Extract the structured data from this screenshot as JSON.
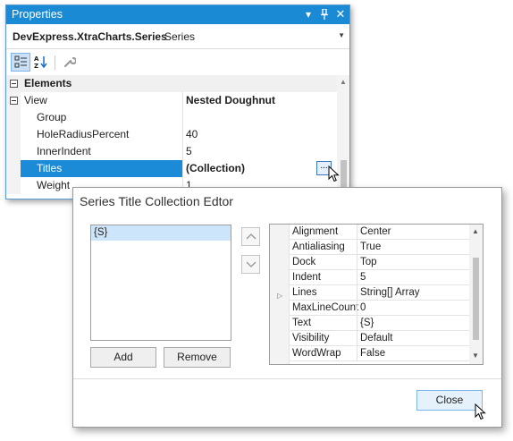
{
  "properties_window": {
    "title": "Properties",
    "title_buttons": {
      "dropdown": "▾",
      "pin": "📌",
      "close": "✕"
    },
    "object_name": "DevExpress.XtraCharts.Series",
    "object_type": "Series",
    "toolbar": {
      "categorized_icon": "categorized-icon",
      "alphabetical_icon": "alphabetical-icon",
      "property_pages_icon": "wrench-icon"
    },
    "rows": [
      {
        "name": "Elements",
        "value": ""
      },
      {
        "name": "View",
        "value": "Nested Doughnut"
      },
      {
        "name": "Group",
        "value": ""
      },
      {
        "name": "HoleRadiusPercent",
        "value": "40"
      },
      {
        "name": "InnerIndent",
        "value": "5"
      },
      {
        "name": "Titles",
        "value": "(Collection)"
      },
      {
        "name": "Weight",
        "value": "1"
      }
    ],
    "ellipsis_label": "..."
  },
  "editor": {
    "title": "Series Title Collection Edtor",
    "list_items": [
      "{S}"
    ],
    "add_label": "Add",
    "remove_label": "Remove",
    "close_label": "Close",
    "properties": [
      {
        "name": "Alignment",
        "value": "Center"
      },
      {
        "name": "Antialiasing",
        "value": "True"
      },
      {
        "name": "Dock",
        "value": "Top"
      },
      {
        "name": "Indent",
        "value": "5"
      },
      {
        "name": "Lines",
        "value": "String[] Array"
      },
      {
        "name": "MaxLineCount",
        "value": "0"
      },
      {
        "name": "Text",
        "value": "{S}"
      },
      {
        "name": "Visibility",
        "value": "Default"
      },
      {
        "name": "WordWrap",
        "value": "False"
      }
    ]
  },
  "colors": {
    "title_bar": "#1a8ad5",
    "selection": "#1b8ad7",
    "list_selection": "#cde5fa"
  }
}
